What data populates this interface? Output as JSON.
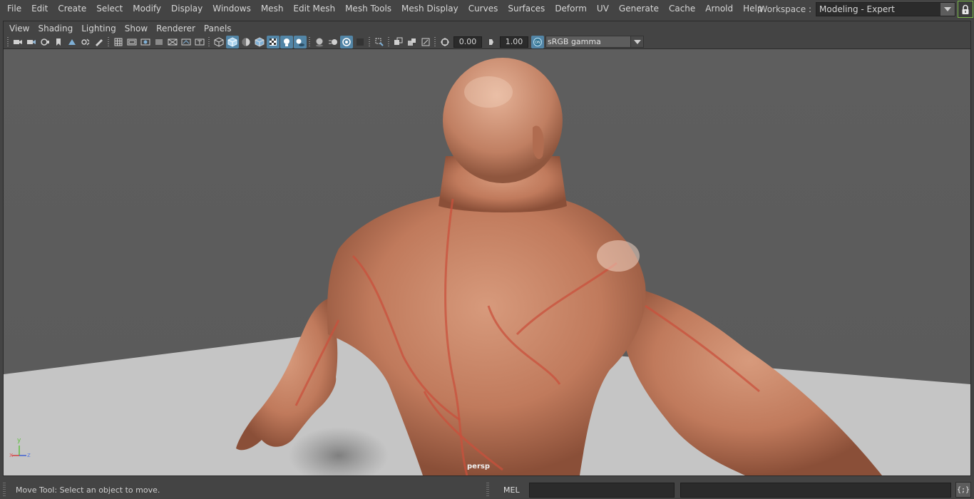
{
  "menubar": {
    "items": [
      "File",
      "Edit",
      "Create",
      "Select",
      "Modify",
      "Display",
      "Windows",
      "Mesh",
      "Edit Mesh",
      "Mesh Tools",
      "Mesh Display",
      "Curves",
      "Surfaces",
      "Deform",
      "UV",
      "Generate",
      "Cache",
      "Arnold",
      "Help"
    ],
    "workspace_label": "Workspace :",
    "workspace_value": "Modeling - Expert"
  },
  "panel": {
    "menus": [
      "View",
      "Shading",
      "Lighting",
      "Show",
      "Renderer",
      "Panels"
    ],
    "toolbar": {
      "exposure": "0.00",
      "gamma": "1.00",
      "color_space": "sRGB gamma",
      "accent_color": "#5285a6"
    },
    "camera_label": "persp",
    "axis": {
      "x": "x",
      "y": "y",
      "z": "z"
    }
  },
  "statusbar": {
    "help_line": "Move Tool: Select an object to move.",
    "script_mode": "MEL",
    "script_button": "{;}"
  }
}
